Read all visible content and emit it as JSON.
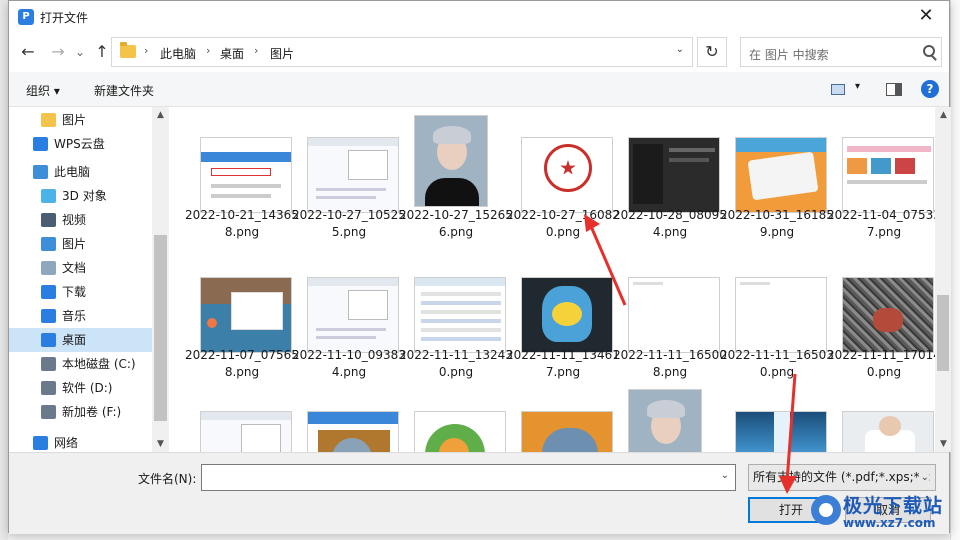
{
  "window": {
    "title": "打开文件",
    "close_glyph": "✕"
  },
  "nav": {
    "back": "←",
    "forward": "→",
    "recent": "⌄",
    "up": "↑",
    "breadcrumb": [
      "此电脑",
      "桌面",
      "图片"
    ],
    "crumb_sep": "›",
    "refresh": "↻",
    "search_placeholder": "在 图片 中搜索"
  },
  "toolbar": {
    "organize": "组织 ▾",
    "new_folder": "新建文件夹",
    "help": "?"
  },
  "sidebar": {
    "items": [
      {
        "label": "图片",
        "icon": "folder-icon",
        "color": "#f3c34a"
      },
      {
        "label": "WPS云盘",
        "icon": "cloud-icon",
        "color": "#2a7de1"
      },
      {
        "label": "此电脑",
        "icon": "computer-icon",
        "color": "#3c8fd8"
      },
      {
        "label": "3D 对象",
        "icon": "cube-icon",
        "color": "#4bb3e8"
      },
      {
        "label": "视频",
        "icon": "film-icon",
        "color": "#4a5d72"
      },
      {
        "label": "图片",
        "icon": "pictures-icon",
        "color": "#3c8fd8"
      },
      {
        "label": "文档",
        "icon": "document-icon",
        "color": "#8fa6bf"
      },
      {
        "label": "下载",
        "icon": "download-icon",
        "color": "#2a7de1"
      },
      {
        "label": "音乐",
        "icon": "music-icon",
        "color": "#2a7de1"
      },
      {
        "label": "桌面",
        "icon": "desktop-icon",
        "color": "#2a7de1",
        "selected": true
      },
      {
        "label": "本地磁盘 (C:)",
        "icon": "drive-icon",
        "color": "#6b7a8a"
      },
      {
        "label": "软件 (D:)",
        "icon": "drive-icon",
        "color": "#6b7a8a"
      },
      {
        "label": "新加卷 (F:)",
        "icon": "drive-icon",
        "color": "#6b7a8a"
      },
      {
        "label": "网络",
        "icon": "network-icon",
        "color": "#2a7de1"
      }
    ]
  },
  "files": [
    {
      "name": "2022-10-21_143658.png",
      "thumb": "screenshot-dialog"
    },
    {
      "name": "2022-10-27_105255.png",
      "thumb": "screenshot-doc"
    },
    {
      "name": "2022-10-27_152656.png",
      "thumb": "portrait"
    },
    {
      "name": "2022-10-27_160820.png",
      "thumb": "seal"
    },
    {
      "name": "2022-10-28_080954.png",
      "thumb": "screenshot-dark"
    },
    {
      "name": "2022-10-31_161859.png",
      "thumb": "cartoon-keyboard"
    },
    {
      "name": "2022-11-04_075337.png",
      "thumb": "screenshot-web"
    },
    {
      "name": "2022-11-07_075658.png",
      "thumb": "screenshot-desktop"
    },
    {
      "name": "2022-11-10_093834.png",
      "thumb": "screenshot-doc"
    },
    {
      "name": "2022-11-11_132430.png",
      "thumb": "screenshot-table"
    },
    {
      "name": "2022-11-11_134617.png",
      "thumb": "cartoon-dark"
    },
    {
      "name": "2022-11-11_165008.png",
      "thumb": "screenshot-blank"
    },
    {
      "name": "2022-11-11_165030.png",
      "thumb": "screenshot-blank"
    },
    {
      "name": "2022-11-11_170140.png",
      "thumb": "texture"
    },
    {
      "name": "",
      "thumb": "screenshot-doc"
    },
    {
      "name": "",
      "thumb": "cartoon-blue"
    },
    {
      "name": "",
      "thumb": "cartoon-green"
    },
    {
      "name": "",
      "thumb": "cartoon-orange"
    },
    {
      "name": "",
      "thumb": "portrait"
    },
    {
      "name": "",
      "thumb": "waterfall"
    },
    {
      "name": "",
      "thumb": "tshirt"
    }
  ],
  "bottom": {
    "filename_label": "文件名(N):",
    "filename_value": "",
    "filetype": "所有支持的文件 (*.pdf;*.xps;*.c",
    "open": "打开",
    "cancel": "取消",
    "dropdown": "⌄"
  },
  "watermark": {
    "title": "极光下载站",
    "url": "www.xz7.com"
  },
  "colors": {
    "accent": "#0078d7",
    "selected": "#cce4f7",
    "annotation": "#e5302c"
  }
}
